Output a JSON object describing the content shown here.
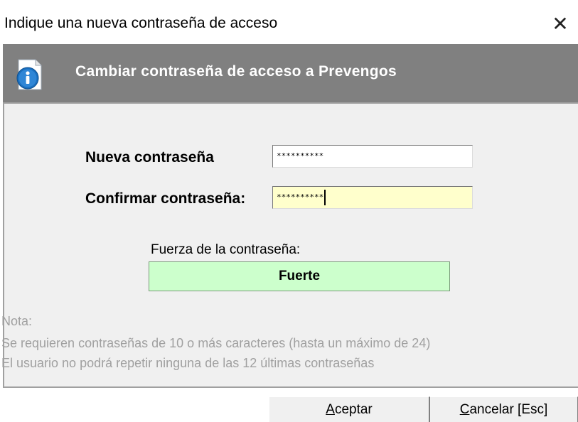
{
  "window": {
    "title": "Indique una nueva contraseña de acceso",
    "close_glyph": "✕"
  },
  "header": {
    "icon": "info-icon",
    "text": "Cambiar contraseña de acceso a Prevengos"
  },
  "form": {
    "new_password_label": "Nueva contraseña",
    "new_password_value": "**********",
    "confirm_password_label": "Confirmar contraseña:",
    "confirm_password_value": "**********"
  },
  "strength": {
    "label": "Fuerza de la contraseña:",
    "value": "Fuerte",
    "color": "#ccffcc"
  },
  "note": {
    "title": "Nota:",
    "line1": "Se requieren contraseñas de 10 o más caracteres (hasta un máximo de 24)",
    "line2": "El usuario no podrá repetir ninguna de las 12 últimas contraseñas"
  },
  "buttons": {
    "accept_first": "A",
    "accept_rest": "ceptar",
    "cancel_first": "C",
    "cancel_rest": "ancelar [Esc]"
  },
  "colors": {
    "header_bg": "#808080",
    "confirm_field_bg": "#ffffcc",
    "note_text": "#a0a0a0"
  }
}
